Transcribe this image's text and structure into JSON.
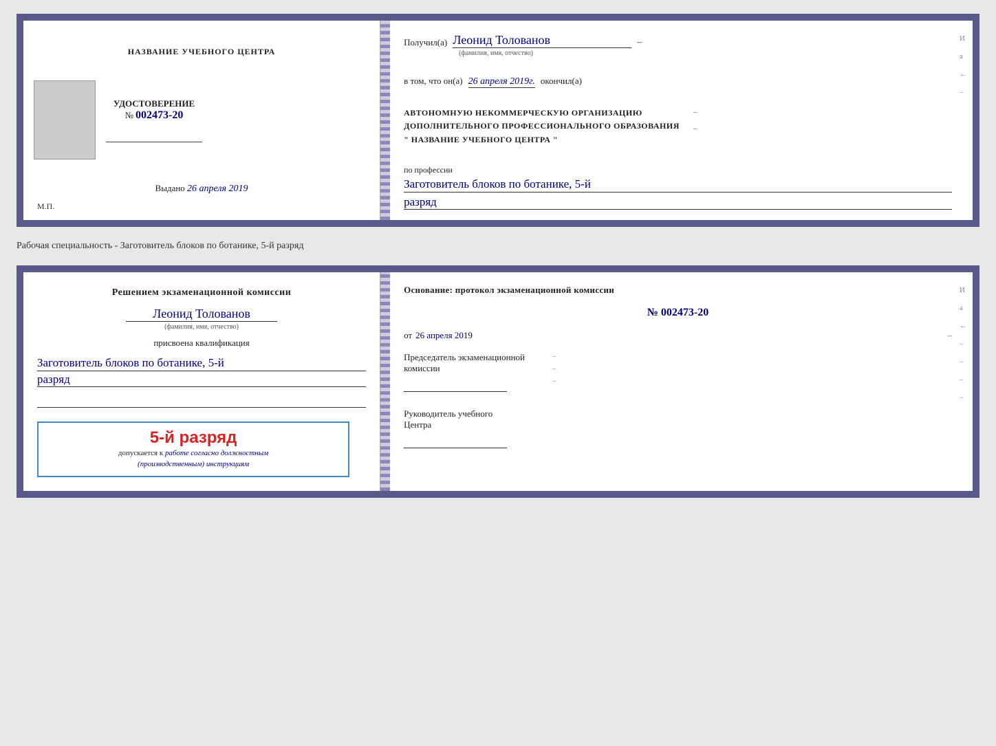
{
  "doc1": {
    "left": {
      "center_title": "НАЗВАНИЕ УЧЕБНОГО ЦЕНТРА",
      "cert_label": "УДОСТОВЕРЕНИЕ",
      "cert_number_prefix": "№",
      "cert_number": "002473-20",
      "issued_label": "Выдано",
      "issued_date": "26 апреля 2019",
      "mp_label": "М.П."
    },
    "right": {
      "received_prefix": "Получил(а)",
      "recipient_name": "Леонид Толованов",
      "recipient_subtitle": "(фамилия, имя, отчество)",
      "date_prefix": "в том, что он(а)",
      "date_handwritten": "26 апреля 2019г.",
      "date_suffix": "окончил(а)",
      "org_line1": "АВТОНОМНУЮ НЕКОММЕРЧЕСКУЮ ОРГАНИЗАЦИЮ",
      "org_line2": "ДОПОЛНИТЕЛЬНОГО ПРОФЕССИОНАЛЬНОГО ОБРАЗОВАНИЯ",
      "org_line3": "\" НАЗВАНИЕ УЧЕБНОГО ЦЕНТРА \"",
      "profession_label": "по профессии",
      "profession_value": "Заготовитель блоков по ботанике, 5-й",
      "razryad_value": "разряд",
      "dash1": "–",
      "dash2": "–",
      "dash3": "–",
      "side_i": "И",
      "side_a": "а",
      "side_arrow": "←",
      "side_dash": "–"
    }
  },
  "specialty_text": "Рабочая специальность - Заготовитель блоков по ботанике, 5-й разряд",
  "doc2": {
    "left": {
      "decision_text": "Решением экзаменационной комиссии",
      "person_name": "Леонид Толованов",
      "person_subtitle": "(фамилия, имя, отчество)",
      "assigned_label": "присвоена квалификация",
      "qualification_value": "Заготовитель блоков по ботанике, 5-й",
      "razryad_value": "разряд",
      "stamp_grade": "5-й разряд",
      "stamp_admission_prefix": "допускается к",
      "stamp_admission_italic": "работе согласно должностным",
      "stamp_admission_italic2": "(производственным) инструкциям"
    },
    "right": {
      "basis_label": "Основание: протокол экзаменационной комиссии",
      "protocol_number": "№  002473-20",
      "from_prefix": "от",
      "from_date": "26 апреля 2019",
      "chairman_label": "Председатель экзаменационной",
      "chairman_label2": "комиссии",
      "head_label": "Руководитель учебного",
      "head_label2": "Центра",
      "dash1": "–",
      "dash2": "–",
      "dash3": "–",
      "side_i": "И",
      "side_a": "а",
      "side_arrow": "←",
      "side_dashes": [
        "–",
        "–",
        "–",
        "–"
      ]
    }
  }
}
